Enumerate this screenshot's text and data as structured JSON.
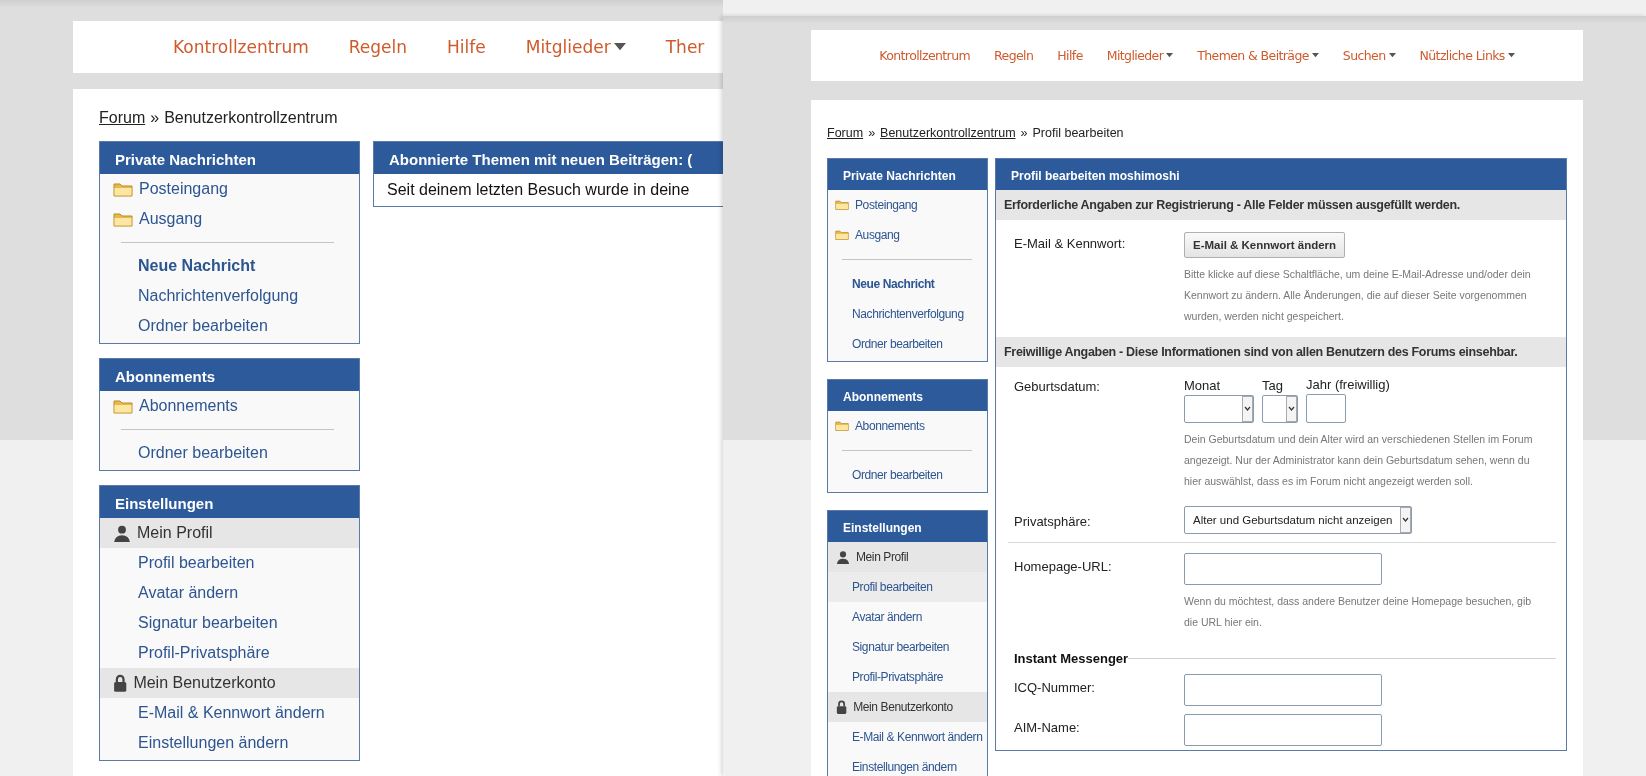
{
  "left_page": {
    "nav": [
      {
        "label": "Kontrollzentrum",
        "dropdown": false
      },
      {
        "label": "Regeln",
        "dropdown": false
      },
      {
        "label": "Hilfe",
        "dropdown": false
      },
      {
        "label": "Mitglieder",
        "dropdown": true
      },
      {
        "label": "Ther",
        "dropdown": false
      }
    ],
    "breadcrumb": [
      {
        "kind": "link",
        "label": "Forum"
      },
      {
        "kind": "separator",
        "label": "»"
      },
      {
        "kind": "current",
        "label": "Benutzerkontrollzentrum"
      }
    ],
    "sidebar": [
      {
        "title": "Private Nachrichten",
        "items": [
          {
            "kind": "folder",
            "label": "Posteingang"
          },
          {
            "kind": "folder",
            "label": "Ausgang"
          },
          {
            "kind": "divider"
          },
          {
            "kind": "action",
            "label": "Neue Nachricht"
          },
          {
            "kind": "link",
            "label": "Nachrichtenverfolgung"
          },
          {
            "kind": "link",
            "label": "Ordner bearbeiten"
          }
        ]
      },
      {
        "title": "Abonnements",
        "items": [
          {
            "kind": "folder",
            "label": "Abonnements"
          },
          {
            "kind": "divider"
          },
          {
            "kind": "link",
            "label": "Ordner bearbeiten"
          }
        ]
      },
      {
        "title": "Einstellungen",
        "items": [
          {
            "kind": "user-group",
            "label": "Mein Profil"
          },
          {
            "kind": "link",
            "label": "Profil bearbeiten"
          },
          {
            "kind": "link",
            "label": "Avatar ändern"
          },
          {
            "kind": "link",
            "label": "Signatur bearbeiten"
          },
          {
            "kind": "link",
            "label": "Profil-Privatsphäre"
          },
          {
            "kind": "lock-group",
            "label": "Mein Benutzerkonto"
          },
          {
            "kind": "link",
            "label": "E-Mail & Kennwort ändern"
          },
          {
            "kind": "link",
            "label": "Einstellungen ändern"
          }
        ]
      }
    ],
    "main": {
      "title": "Abonnierte Themen mit neuen Beiträgen: (",
      "text": "Seit deinem letzten Besuch wurde in deine"
    }
  },
  "right_page": {
    "nav": [
      {
        "label": "Kontrollzentrum",
        "dropdown": false
      },
      {
        "label": "Regeln",
        "dropdown": false
      },
      {
        "label": "Hilfe",
        "dropdown": false
      },
      {
        "label": "Mitglieder",
        "dropdown": true
      },
      {
        "label": "Themen & Beiträge",
        "dropdown": true
      },
      {
        "label": "Suchen",
        "dropdown": true
      },
      {
        "label": "Nützliche Links",
        "dropdown": true
      }
    ],
    "breadcrumb": [
      {
        "kind": "link",
        "label": "Forum"
      },
      {
        "kind": "separator",
        "label": "»"
      },
      {
        "kind": "link",
        "label": "Benutzerkontrollzentrum"
      },
      {
        "kind": "separator",
        "label": "»"
      },
      {
        "kind": "current",
        "label": "Profil bearbeiten"
      }
    ],
    "sidebar": [
      {
        "title": "Private Nachrichten",
        "items": [
          {
            "kind": "folder",
            "label": "Posteingang",
            "selected": false
          },
          {
            "kind": "folder",
            "label": "Ausgang",
            "selected": false
          },
          {
            "kind": "divider"
          },
          {
            "kind": "action",
            "label": "Neue Nachricht",
            "selected": false
          },
          {
            "kind": "link",
            "label": "Nachrichtenverfolgung",
            "selected": false
          },
          {
            "kind": "link",
            "label": "Ordner bearbeiten",
            "selected": false
          }
        ]
      },
      {
        "title": "Abonnements",
        "items": [
          {
            "kind": "folder",
            "label": "Abonnements",
            "selected": false
          },
          {
            "kind": "divider"
          },
          {
            "kind": "link",
            "label": "Ordner bearbeiten",
            "selected": false
          }
        ]
      },
      {
        "title": "Einstellungen",
        "items": [
          {
            "kind": "user-group",
            "label": "Mein Profil"
          },
          {
            "kind": "link",
            "label": "Profil bearbeiten",
            "selected": true
          },
          {
            "kind": "link",
            "label": "Avatar ändern",
            "selected": false
          },
          {
            "kind": "link",
            "label": "Signatur bearbeiten",
            "selected": false
          },
          {
            "kind": "link",
            "label": "Profil-Privatsphäre",
            "selected": false
          },
          {
            "kind": "lock-group",
            "label": "Mein Benutzerkonto"
          },
          {
            "kind": "link",
            "label": "E-Mail & Kennwort ändern",
            "selected": false
          },
          {
            "kind": "link",
            "label": "Einstellungen ändern",
            "selected": false
          }
        ]
      }
    ],
    "main": {
      "title": "Profil bearbeiten moshimoshi",
      "sections": [
        {
          "title": "Erforderliche Angaben zur Registrierung - Alle Felder müssen ausgefüllt werden.",
          "rows": [
            {
              "kind": "button",
              "label": "E-Mail & Kennwort:",
              "button": "E-Mail & Kennwort ändern",
              "help": "Bitte klicke auf diese Schaltfläche, um deine E-Mail-Adresse und/oder dein Kennwort zu ändern. Alle Änderungen, die auf dieser Seite vorgenommen wurden, werden nicht gespeichert."
            }
          ]
        },
        {
          "title": "Freiwillige Angaben - Diese Informationen sind von allen Benutzern des Forums einsehbar.",
          "rows": [
            {
              "kind": "date",
              "label": "Geburtsdatum:",
              "fields": [
                {
                  "kind": "select",
                  "caption": "Monat"
                },
                {
                  "kind": "small-select",
                  "caption": "Tag"
                },
                {
                  "kind": "input",
                  "caption": "Jahr (freiwillig)"
                }
              ],
              "help": "Dein Geburtsdatum und dein Alter wird an verschiedenen Stellen im Forum angezeigt. Nur der Administrator kann dein Geburtsdatum sehen, wenn du hier auswählst, dass es im Forum nicht angezeigt werden soll."
            },
            {
              "kind": "select",
              "label": "Privatsphäre:",
              "value": "Alter und Geburtsdatum nicht anzeigen"
            },
            {
              "kind": "rule"
            },
            {
              "kind": "input",
              "label": "Homepage-URL:",
              "help": "Wenn du möchtest, dass andere Benutzer deine Homepage besuchen, gib die URL hier ein."
            },
            {
              "kind": "subheading",
              "label": "Instant Messenger"
            },
            {
              "kind": "input",
              "label": "ICQ-Nummer:"
            },
            {
              "kind": "input",
              "label": "AIM-Name:"
            }
          ]
        }
      ]
    }
  }
}
